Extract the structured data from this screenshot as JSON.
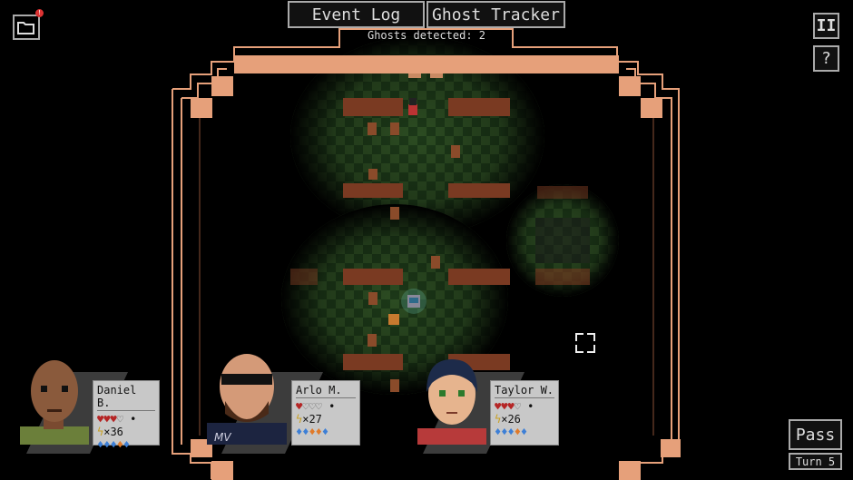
{
  "toolbar": {
    "event_log_label": "Event Log",
    "ghost_tracker_label": "Ghost Tracker",
    "ghosts_detected": "Ghosts detected: 2",
    "pause_symbol": "II",
    "help_symbol": "?",
    "folder_icon": "folder-icon",
    "notification_badge": "!"
  },
  "characters": [
    {
      "name": "Daniel B.",
      "hearts_full": 3,
      "hearts_total": 4,
      "energy": "×36",
      "icon": "avatar-daniel"
    },
    {
      "name": "Arlo M.",
      "hearts_full": 1,
      "hearts_total": 4,
      "energy": "×27",
      "icon": "avatar-arlo"
    },
    {
      "name": "Taylor W.",
      "hearts_full": 3,
      "hearts_total": 4,
      "energy": "×26",
      "icon": "avatar-taylor"
    }
  ],
  "controls": {
    "pass_label": "Pass",
    "turn_label": "Turn 5"
  },
  "colors": {
    "frame": "#e6a07a",
    "floor_dark": "#1f3a1a",
    "floor_light": "#2d4d24",
    "card_bg": "#c8c8c8",
    "heart": "#b52525",
    "drop_blue": "#3d7fd6",
    "drop_orange": "#e07a2a"
  }
}
